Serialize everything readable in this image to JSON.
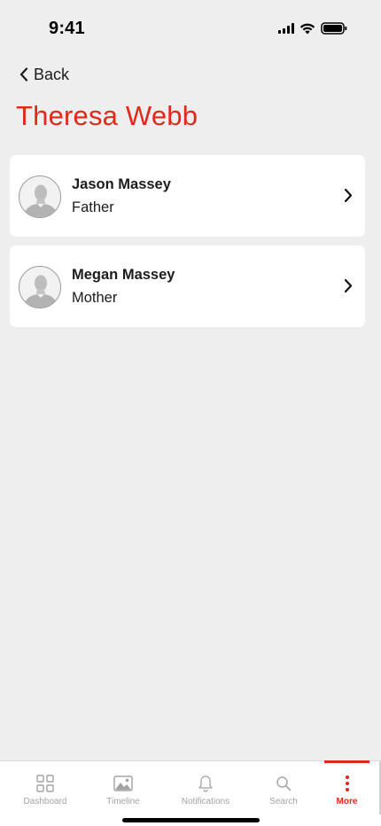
{
  "status_bar": {
    "time": "9:41"
  },
  "nav": {
    "back_label": "Back"
  },
  "page": {
    "title": "Theresa Webb"
  },
  "contacts": [
    {
      "name": "Jason Massey",
      "relation": "Father"
    },
    {
      "name": "Megan Massey",
      "relation": "Mother"
    }
  ],
  "tab_bar": {
    "items": [
      {
        "label": "Dashboard",
        "icon": "dashboard-grid-icon",
        "active": false
      },
      {
        "label": "Timeline",
        "icon": "image-icon",
        "active": false
      },
      {
        "label": "Notifications",
        "icon": "bell-icon",
        "active": false
      },
      {
        "label": "Search",
        "icon": "search-icon",
        "active": false
      },
      {
        "label": "More",
        "icon": "more-vertical-icon",
        "active": true
      }
    ]
  },
  "colors": {
    "accent": "#e2271b",
    "background": "#edeeed",
    "card": "#ffffff",
    "inactive": "#a3a3a3"
  }
}
